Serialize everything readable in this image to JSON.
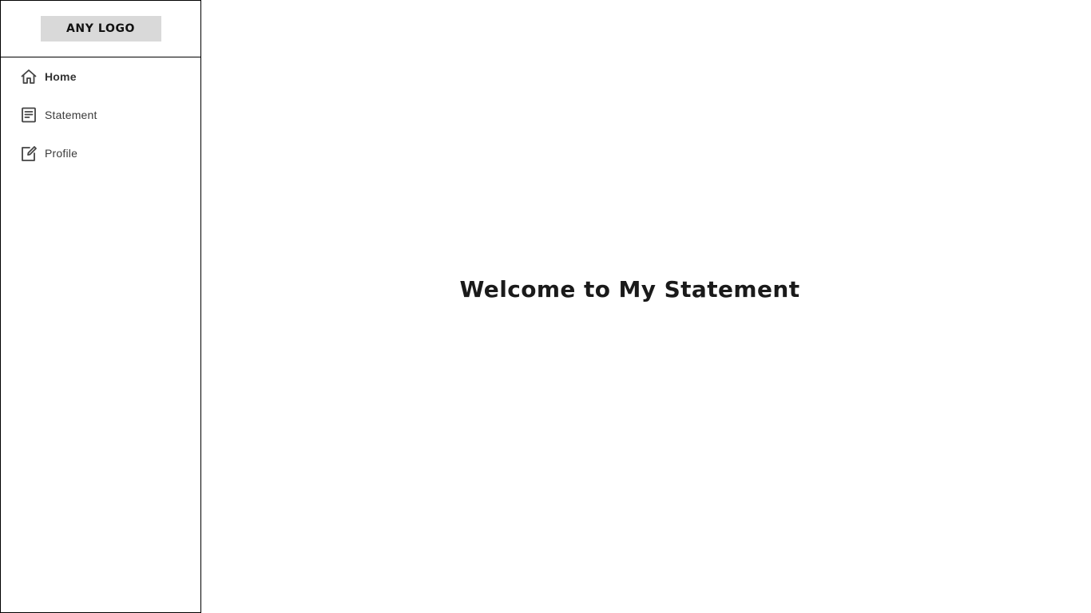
{
  "sidebar": {
    "logo_text": "ANY LOGO",
    "items": [
      {
        "label": "Home",
        "icon": "home-icon",
        "active": true
      },
      {
        "label": "Statement",
        "icon": "document-icon",
        "active": false
      },
      {
        "label": "Profile",
        "icon": "edit-icon",
        "active": false
      }
    ]
  },
  "main": {
    "welcome_text": "Welcome to My Statement"
  },
  "colors": {
    "border": "#000000",
    "logo_bg": "#d9d9d9",
    "text": "#1a1a1a",
    "nav_text": "#3a3a3a"
  }
}
